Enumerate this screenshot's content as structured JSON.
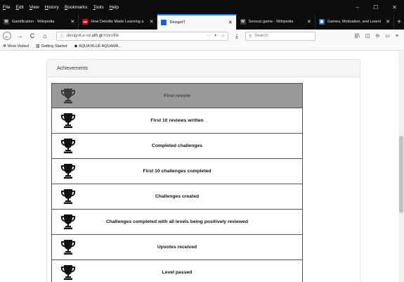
{
  "menu": [
    "File",
    "Edit",
    "View",
    "History",
    "Bookmarks",
    "Tools",
    "Help"
  ],
  "window_controls": [
    "–",
    "☐",
    "✕"
  ],
  "tabs": [
    {
      "title": "Gamification - Wikipedia",
      "favicon": "W",
      "favicon_color": "#3d3d3d",
      "active": false
    },
    {
      "title": "How Deloitte Made Learning a",
      "favicon": "▬",
      "favicon_color": "#d0021b",
      "active": false
    },
    {
      "title": "DesignIT",
      "favicon": "",
      "favicon_color": "#1565c0",
      "active": true
    },
    {
      "title": "Serious game - Wikipedia",
      "favicon": "W",
      "favicon_color": "#3d3d3d",
      "active": false
    },
    {
      "title": "Games, Motivation, and Learni",
      "favicon": "▦",
      "favicon_color": "#2f6fb0",
      "active": false
    }
  ],
  "newtab_label": "+",
  "tab_close": "✕",
  "nav": {
    "back": "←",
    "forward": "→",
    "reload": "C",
    "home": "⌂",
    "url_prefix": "designit.e-ce.",
    "url_domain": "uth.gr",
    "url_suffix": "/#/profile",
    "page_actions": [
      "···",
      "◐",
      "☆"
    ],
    "download": "⤓",
    "search_placeholder": "Search",
    "toolbar_icons": [
      "|||\\",
      "◫",
      "⊖",
      "▭",
      "≡"
    ]
  },
  "bookmarks": [
    {
      "label": "Most Visited",
      "icon": "✲"
    },
    {
      "label": "Getting Started",
      "icon": "▥"
    },
    {
      "label": "AQUA BLUE AQUAMA...",
      "icon": "◆"
    }
  ],
  "panel": {
    "title": "Achievements"
  },
  "achievements": [
    {
      "label": "First review",
      "locked": true
    },
    {
      "label": "First 10 reviews written",
      "locked": false
    },
    {
      "label": "Completed challenges",
      "locked": false
    },
    {
      "label": "First 10 challenges completed",
      "locked": false
    },
    {
      "label": "Challenges created",
      "locked": false
    },
    {
      "label": "Challenges completed with all levels being positively reviewed",
      "locked": false
    },
    {
      "label": "Upvotes received",
      "locked": false
    },
    {
      "label": "Level passed",
      "locked": false
    }
  ],
  "colors": {
    "accent": "#0a84ff",
    "locked_row": "#9a9a9a",
    "trophy_locked": "#3a3a3a",
    "trophy_unlocked": "#111111"
  }
}
